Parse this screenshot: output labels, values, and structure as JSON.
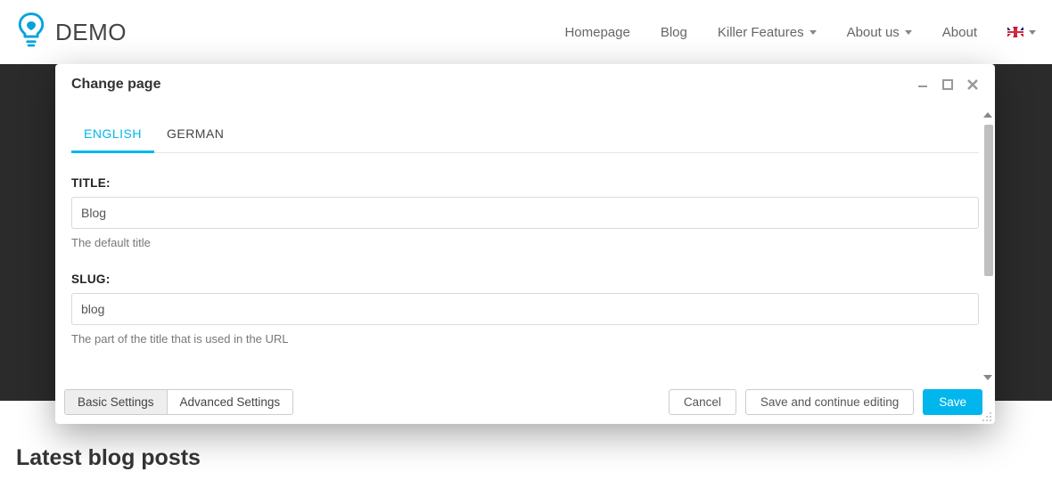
{
  "brand": "DEMO",
  "nav": {
    "items": [
      {
        "label": "Homepage",
        "has_dropdown": false
      },
      {
        "label": "Blog",
        "has_dropdown": false
      },
      {
        "label": "Killer Features",
        "has_dropdown": true
      },
      {
        "label": "About us",
        "has_dropdown": true
      },
      {
        "label": "About",
        "has_dropdown": false
      }
    ]
  },
  "modal": {
    "title": "Change page",
    "tabs": [
      {
        "label": "ENGLISH",
        "active": true
      },
      {
        "label": "GERMAN",
        "active": false
      }
    ],
    "fields": {
      "title": {
        "label": "TITLE:",
        "value": "Blog",
        "help": "The default title"
      },
      "slug": {
        "label": "SLUG:",
        "value": "blog",
        "help": "The part of the title that is used in the URL"
      }
    },
    "footer": {
      "settings_tabs": [
        {
          "label": "Basic Settings",
          "active": true
        },
        {
          "label": "Advanced Settings",
          "active": false
        }
      ],
      "cancel": "Cancel",
      "save_continue": "Save and continue editing",
      "save": "Save"
    }
  },
  "page": {
    "heading": "Latest blog posts"
  }
}
